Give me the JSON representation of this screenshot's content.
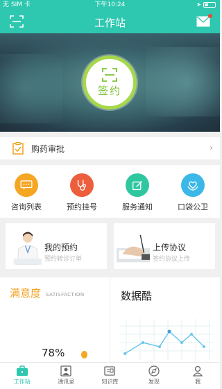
{
  "status_bar": {
    "carrier": "无 SIM 卡",
    "time": "下午10:24"
  },
  "header": {
    "title": "工作站"
  },
  "sign": {
    "label": "签约"
  },
  "approval": {
    "label": "购药审批",
    "chevron": "›"
  },
  "grid": [
    {
      "label": "咨询列表",
      "icon": "chat-icon",
      "color": "#f5a623"
    },
    {
      "label": "预约挂号",
      "icon": "stethoscope-icon",
      "color": "#ec5e3c"
    },
    {
      "label": "服务通知",
      "icon": "edit-icon",
      "color": "#2ec7a0"
    },
    {
      "label": "口袋公卫",
      "icon": "heart-hands-icon",
      "color": "#3bb8e8"
    }
  ],
  "cards": [
    {
      "title": "我的预约",
      "subtitle": "预约转诊订单"
    },
    {
      "title": "上传协议",
      "subtitle": "签约协议上传"
    }
  ],
  "satisfaction": {
    "title": "满意度",
    "subtitle": "SATISFACTION",
    "value": "78%"
  },
  "data_cool": {
    "title": "数据酷"
  },
  "tabbar": [
    {
      "label": "工作站",
      "icon": "briefcase-icon",
      "active": true
    },
    {
      "label": "通讯录",
      "icon": "contacts-icon",
      "active": false
    },
    {
      "label": "知识库",
      "icon": "book-icon",
      "active": false
    },
    {
      "label": "发现",
      "icon": "compass-icon",
      "active": false
    },
    {
      "label": "我",
      "icon": "person-icon",
      "active": false
    }
  ],
  "colors": {
    "primary": "#2ec7b0",
    "sign_ring": "#a7d84b",
    "satisfaction": "#f0a020"
  }
}
